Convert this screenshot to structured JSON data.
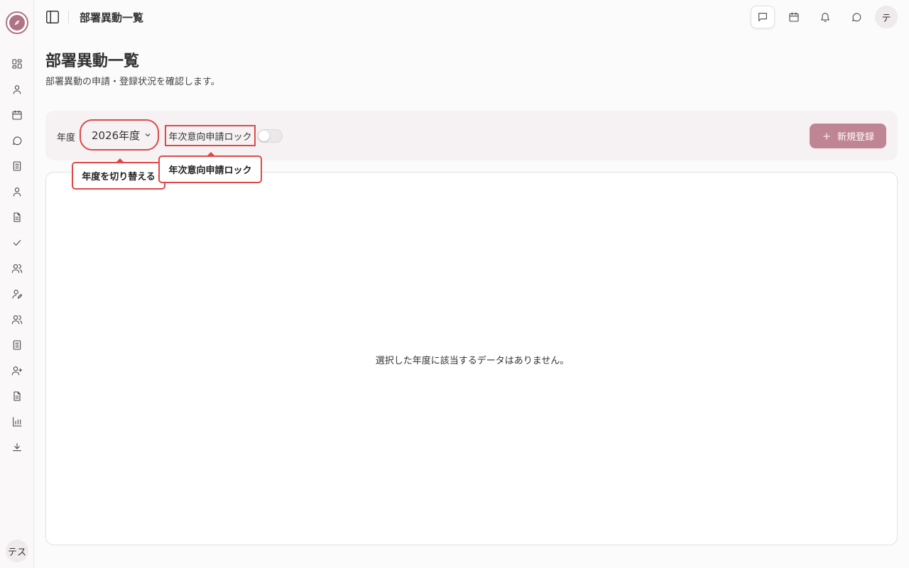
{
  "header": {
    "breadcrumb_title": "部署異動一覧",
    "avatar_initial": "テ"
  },
  "sidebar": {
    "user_initial": "テス"
  },
  "page": {
    "title": "部署異動一覧",
    "subtitle": "部署異動の申請・登録状況を確認します。"
  },
  "filters": {
    "year_label": "年度",
    "year_selected": "2026年度",
    "lock_label": "年次意向申請ロック",
    "lock_enabled": false,
    "new_button_label": "新規登録"
  },
  "tooltips": {
    "year_switch": "年度を切り替える",
    "lock": "年次意向申請ロック"
  },
  "content": {
    "empty_message": "選択した年度に該当するデータはありません。"
  },
  "colors": {
    "accent": "#c08594",
    "highlight": "#e04848"
  },
  "icons": {
    "sidebar": [
      "dashboard-icon",
      "user-icon",
      "calendar-icon",
      "chat-icon",
      "notebook-icon",
      "user-icon",
      "document-icon",
      "check-icon",
      "users-icon",
      "user-edit-icon",
      "users-icon",
      "notebook-icon",
      "user-plus-icon",
      "document-icon",
      "bar-chart-icon",
      "download-icon"
    ],
    "topbar": [
      "message-square-icon",
      "calendar-icon",
      "bell-icon",
      "chat-icon"
    ]
  }
}
